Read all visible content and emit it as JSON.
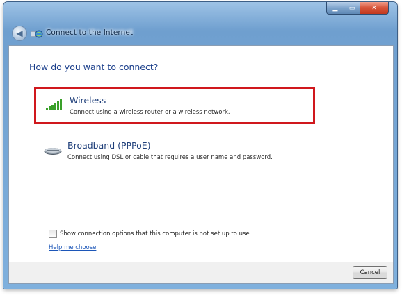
{
  "window": {
    "title": "Connect to the Internet",
    "caption_buttons": {
      "minimize": "▁",
      "maximize": "▭",
      "close": "✕"
    },
    "back_glyph": "◀"
  },
  "main": {
    "heading": "How do you want to connect?",
    "options": [
      {
        "title": "Wireless",
        "description": "Connect using a wireless router or a wireless network.",
        "icon": "wireless-signal-icon",
        "highlighted": true
      },
      {
        "title": "Broadband (PPPoE)",
        "description": "Connect using DSL or cable that requires a user name and password.",
        "icon": "broadband-modem-icon",
        "highlighted": false
      }
    ],
    "show_options_checkbox": {
      "label": "Show connection options that this computer is not set up to use",
      "checked": false
    },
    "help_link": "Help me choose"
  },
  "footer": {
    "cancel_label": "Cancel"
  },
  "colors": {
    "highlight_border": "#d0181d",
    "heading": "#1b3f8b",
    "link": "#1c56b8",
    "signal_green": "#3aa02a"
  }
}
